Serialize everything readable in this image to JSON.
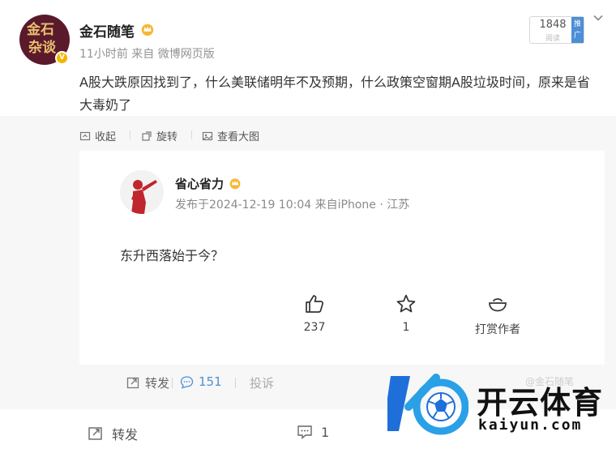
{
  "post": {
    "author": "金石随笔",
    "avatar_text": [
      "金石",
      "杂谈"
    ],
    "verified_badge": "V",
    "meta": "11小时前 来自 微博网页版",
    "text": "A股大跌原因找到了，什么美联储明年不及预期，什么政策空窗期A股垃圾时间，原来是省大毒奶了"
  },
  "promo": {
    "count": "1848",
    "sub": "阅读",
    "tag": "推广"
  },
  "toolbar": {
    "collapse": "收起",
    "rotate": "旋转",
    "view_large": "查看大图"
  },
  "card": {
    "author": "省心省力",
    "meta": "发布于2024-12-19 10:04 来自iPhone · 江苏",
    "body": "东升西落始于今？",
    "likes": "237",
    "favorites": "1",
    "tip": "打赏作者"
  },
  "card_footer": {
    "forward": "转发",
    "comments": "151",
    "report": "投诉"
  },
  "bottom": {
    "forward": "转发",
    "comments": "1"
  },
  "watermark": {
    "cn": "开云体育",
    "en": "kaiyun.com"
  },
  "colors": {
    "accent_blue": "#4c8fd6",
    "gold": "#f5b400",
    "page_bg": "#f7f7f7"
  },
  "icons": [
    "crown-icon",
    "chevron-down-icon",
    "collapse-icon",
    "rotate-icon",
    "image-icon",
    "thumbs-up-icon",
    "star-icon",
    "tip-bowl-icon",
    "forward-icon",
    "comment-icon",
    "ball-logo-icon"
  ]
}
